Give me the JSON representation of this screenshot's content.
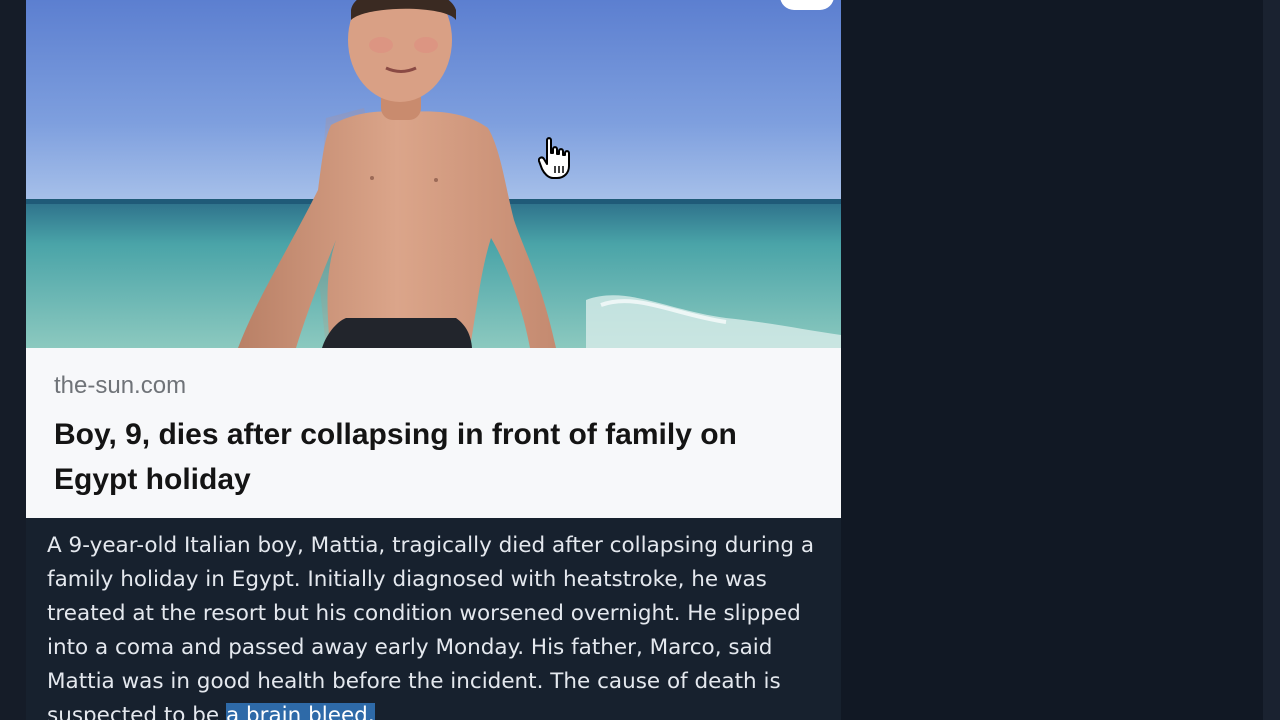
{
  "link_preview": {
    "domain": "the-sun.com",
    "headline": "Boy, 9, dies after collapsing in front of family on Egypt holiday"
  },
  "summary": {
    "text": "A 9-year-old Italian boy, Mattia, tragically died after collapsing during a family holiday in Egypt. Initially diagnosed with heatstroke, he was treated at the resort but his condition worsened overnight. He slipped into a coma and passed away early Monday. His father, Marco, said Mattia was in good health before the incident. The cause of death is suspected to be ",
    "highlighted": "a brain bleed."
  },
  "colors": {
    "page_background": "#0f1521",
    "preview_background": "#f7f8fa",
    "selection": "#2e6aa8"
  }
}
